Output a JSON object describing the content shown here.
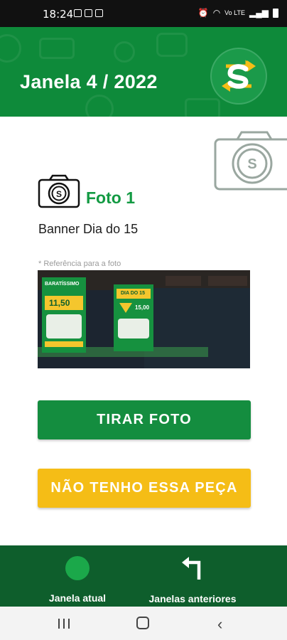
{
  "status_bar": {
    "time": "18:24",
    "signal_text": "Vo LTE"
  },
  "header": {
    "title": "Janela 4 / 2022",
    "logo_icon": "subway-s-logo-icon"
  },
  "photo_section": {
    "title": "Foto 1",
    "subtitle": "Banner Dia do 15",
    "reference_note": "* Referência para a foto",
    "reference_image": {
      "poster1_heading": "BARATÍSSIMO",
      "poster1_price": "11,50",
      "poster2_heading": "DIA DO 15",
      "poster2_price": "15,00"
    }
  },
  "actions": {
    "take_photo_label": "TIRAR FOTO",
    "no_piece_label": "NÃO TENHO ESSA PEÇA"
  },
  "bottom_nav": {
    "items": [
      {
        "label": "Janela atual",
        "icon": "circle-icon"
      },
      {
        "label": "Janelas anteriores",
        "icon": "turn-left-arrow-icon"
      }
    ]
  },
  "colors": {
    "brand_green": "#0e8a3a",
    "accent_green": "#148d3f",
    "brand_yellow": "#f5bd16",
    "nav_dark_green": "#0e5e2c"
  }
}
